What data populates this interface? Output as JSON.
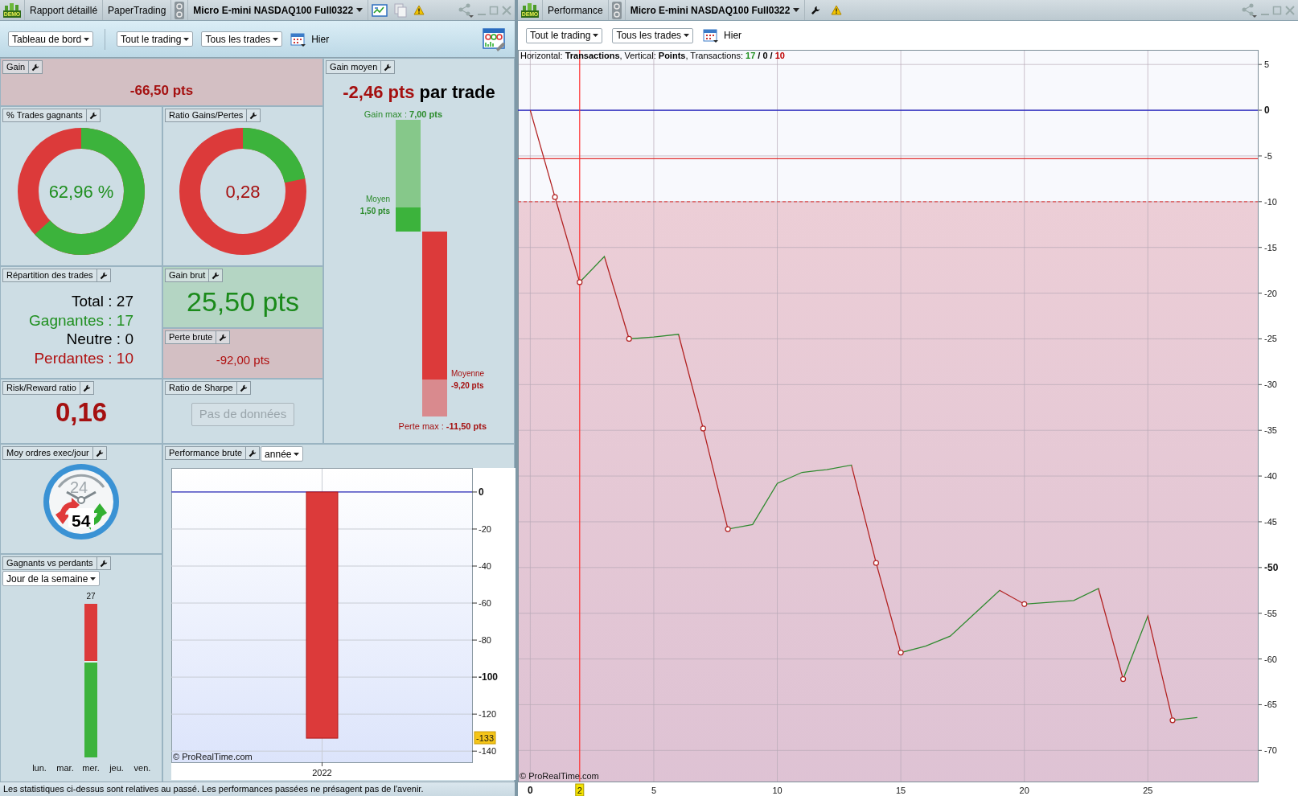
{
  "left_window": {
    "badge": "DEMO",
    "title_parts": [
      "Rapport détaillé",
      "PaperTrading"
    ],
    "instrument": "Micro E-mini NASDAQ100 Full0322",
    "toolbar": {
      "view": "Tableau de bord",
      "dropdowns": [
        "Tout le trading",
        "Tous les trades"
      ],
      "date": "Hier"
    },
    "gain": {
      "title": "Gain",
      "value": "-66,50 pts"
    },
    "gain_moyen": {
      "title": "Gain moyen",
      "value": "-2,46 pts",
      "suffix": "par trade",
      "gain_bar": {
        "max_label": "Gain max :",
        "max_value": "7,00 pts",
        "avg_label": "Moyen",
        "avg_value": "1,50 pts",
        "level": 0.214
      },
      "loss_bar": {
        "avg_label": "Moyenne",
        "avg_value": "-9,20 pts",
        "max_label": "Perte max :",
        "max_value": "-11,50 pts",
        "level": 0.8
      }
    },
    "trades_gagnants": {
      "title": "% Trades gagnants",
      "value": "62,96 %",
      "level": 0.6296
    },
    "ratio_gains_pertes": {
      "title": "Ratio Gains/Pertes",
      "value": "0,28",
      "level": 0.217
    },
    "repartition": {
      "title": "Répartition des trades",
      "lines": [
        {
          "text": "Total : 27",
          "kind": "total"
        },
        {
          "text": "Gagnantes : 17",
          "kind": "win"
        },
        {
          "text": "Neutre : 0",
          "kind": "neutral"
        },
        {
          "text": "Perdantes : 10",
          "kind": "loss"
        }
      ]
    },
    "gain_brut": {
      "title": "Gain brut",
      "value": "25,50 pts"
    },
    "perte_brute": {
      "title": "Perte brute",
      "value": "-92,00 pts"
    },
    "risk_reward": {
      "title": "Risk/Reward ratio",
      "value": "0,16"
    },
    "sharpe": {
      "title": "Ratio de Sharpe",
      "button": "Pas de données",
      "disabled": true
    },
    "ordres": {
      "title": "Moy ordres exec/jour",
      "dial_label": "24",
      "value": "54"
    },
    "gagnants_perdants": {
      "title": "Gagnants vs perdants",
      "dropdown": "Jour de la semaine",
      "days": [
        {
          "label": "lun."
        },
        {
          "label": "mar."
        },
        {
          "label": "mer.",
          "total": "27",
          "wins": {
            "level": 0.6296
          }
        },
        {
          "label": "jeu."
        },
        {
          "label": "ven."
        }
      ]
    },
    "performance_brute": {
      "title": "Performance brute",
      "dropdown": "année",
      "credit": "© ProRealTime.com",
      "chart_data": {
        "type": "bar",
        "categories": [
          "2022"
        ],
        "values": [
          -133
        ],
        "ylim": [
          -146,
          13
        ],
        "yticks": [
          0,
          -20,
          -40,
          -60,
          -80,
          -100,
          -120,
          -140
        ],
        "grid": true,
        "ref_lines": [
          {
            "axis": "y",
            "value": 0,
            "color": "#3030c0"
          }
        ]
      },
      "axis_tag": "-133"
    },
    "status_bar": "Les statistiques ci-dessus sont relatives au passé. Les performances passées ne présagent pas de l'avenir."
  },
  "right_window": {
    "badge": "DEMO",
    "title": "Performance",
    "instrument": "Micro E-mini NASDAQ100 Full0322",
    "toolbar": {
      "dropdowns": [
        "Tout le trading",
        "Tous les trades"
      ],
      "date": "Hier"
    },
    "chart": {
      "caption_parts": [
        {
          "text": "Horizontal: **Transactions**, Vertical: **Points**, Transactions: ",
          "color": "#000000"
        },
        {
          "text": "17",
          "color": "#1f8f1f"
        },
        {
          "text": " / 0 / ",
          "color": "#000000"
        },
        {
          "text": "10",
          "color": "#c00000"
        }
      ],
      "credit": "© ProRealTime.com",
      "chart_data": {
        "type": "line",
        "x": [
          0,
          1,
          2,
          3,
          4,
          5,
          6,
          7,
          8,
          9,
          10,
          11,
          12,
          13,
          14,
          15,
          16,
          17,
          18,
          19,
          20,
          21,
          22,
          23,
          24,
          25,
          26,
          27
        ],
        "series": [
          {
            "color": "#b22222",
            "values": [
              0,
              -9.5,
              -18.8,
              -16,
              -25,
              -24.8,
              -24.5,
              -34.8,
              -45.8,
              -45.3,
              -40.8,
              -39.6,
              -39.3,
              -38.8,
              -49.5,
              -59.3,
              -58.6,
              -57.5,
              -55,
              -52.5,
              -54,
              -53.8,
              -53.6,
              -52.3,
              -62.2,
              -55.3,
              -66.7,
              -66.4
            ]
          }
        ],
        "xlim": [
          -0.5,
          29.45
        ],
        "ylim": [
          -73.4,
          6.6
        ],
        "grid": true,
        "bands": [
          {
            "axis": "y",
            "from": -73.4,
            "to": -10,
            "color": "#e6c8d4"
          }
        ],
        "xticks": [
          0,
          5,
          10,
          15,
          20,
          25
        ],
        "yticks": [
          5,
          0,
          -5,
          -10,
          -15,
          -20,
          -25,
          -30,
          -35,
          -40,
          -45,
          -50,
          -55,
          -60,
          -65,
          -70
        ],
        "ref_lines": [
          {
            "axis": "y",
            "value": 0,
            "color": "#2020c0"
          },
          {
            "axis": "y",
            "value": -5.3,
            "color": "#e03030"
          },
          {
            "axis": "y",
            "value": -10,
            "color": "#e05050"
          },
          {
            "axis": "x",
            "value": 2,
            "label": "2",
            "color": "#ff3030"
          }
        ]
      }
    }
  }
}
